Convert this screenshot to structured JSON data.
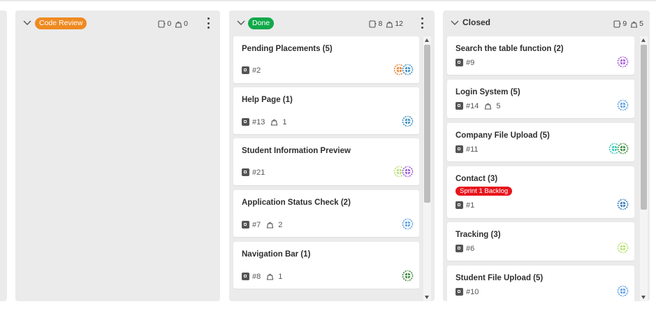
{
  "columns": {
    "code_review": {
      "label": "Code Review",
      "story_count": "0",
      "task_count": "0"
    },
    "done": {
      "label": "Done",
      "story_count": "8",
      "task_count": "12",
      "cards": [
        {
          "title": "Pending Placements (5)",
          "number": "#2",
          "tasks": "",
          "avatar_colors": [
            "#e9822c",
            "#3b8fc0"
          ]
        },
        {
          "title": "Help Page (1)",
          "number": "#13",
          "tasks": "1",
          "avatar_colors": [
            "#3b8fc0"
          ]
        },
        {
          "title": "Student Information Preview",
          "number": "#21",
          "tasks": "",
          "avatar_colors": [
            "#b6df6d",
            "#9a5bd6"
          ]
        },
        {
          "title": "Application Status Check (2)",
          "number": "#7",
          "tasks": "2",
          "avatar_colors": [
            "#5a9de0"
          ]
        },
        {
          "title": "Navigation Bar (1)",
          "number": "#8",
          "tasks": "1",
          "avatar_colors": [
            "#3c8a3a"
          ]
        }
      ]
    },
    "closed": {
      "label": "Closed",
      "story_count": "9",
      "task_count": "5",
      "cards": [
        {
          "title": "Search the table function (2)",
          "number": "#9",
          "tasks": "",
          "label": "",
          "avatar_colors": [
            "#a65ad6"
          ]
        },
        {
          "title": "Login System (5)",
          "number": "#14",
          "tasks": "5",
          "label": "",
          "avatar_colors": [
            "#5a9de0"
          ]
        },
        {
          "title": "Company File Upload (5)",
          "number": "#11",
          "tasks": "",
          "label": "",
          "avatar_colors": [
            "#2fc7b8",
            "#3c8a3a"
          ]
        },
        {
          "title": "Contact (3)",
          "number": "#1",
          "tasks": "",
          "label": "Sprint 1 Backlog",
          "avatar_colors": [
            "#2f78b8"
          ]
        },
        {
          "title": "Tracking (3)",
          "number": "#6",
          "tasks": "",
          "label": "",
          "avatar_colors": [
            "#b6df6d"
          ]
        },
        {
          "title": "Student File Upload (5)",
          "number": "#10",
          "tasks": "",
          "label": "",
          "avatar_colors": [
            "#5a9de0"
          ]
        }
      ]
    }
  },
  "colors": {
    "code_review_badge": "#ef8a21",
    "done_badge": "#11a94a",
    "sprint_label": "#e8141c"
  }
}
